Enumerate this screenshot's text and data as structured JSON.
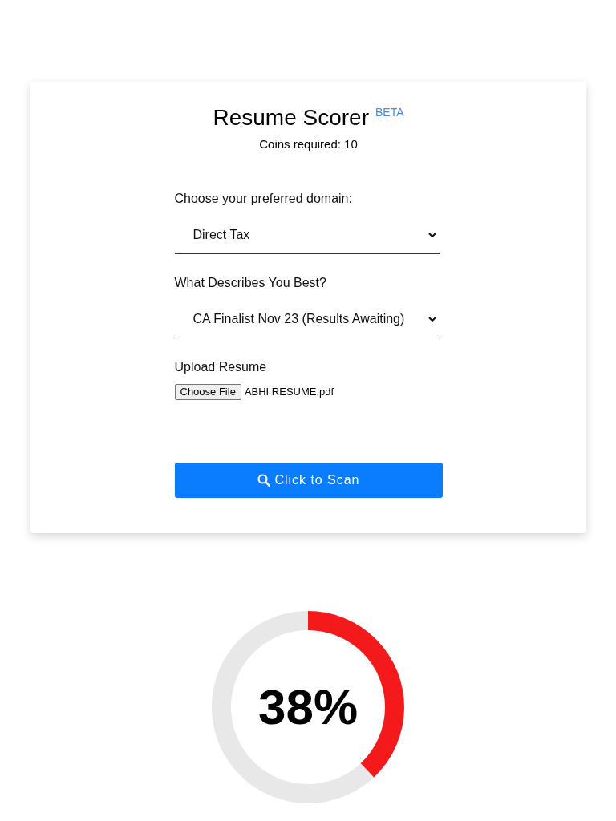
{
  "header": {
    "title": "Resume Scorer",
    "badge": "BETA",
    "coins": "Coins required: 10"
  },
  "fields": [
    {
      "kind": "select",
      "label": "Choose your preferred domain:",
      "value": "Direct Tax"
    },
    {
      "kind": "select",
      "label": "What Describes You Best?",
      "value": "CA Finalist Nov 23 (Results Awaiting)"
    },
    {
      "kind": "file",
      "label": "Upload Resume",
      "button": "Choose File",
      "value": "ABHI RESUME.pdf"
    }
  ],
  "scan_button": {
    "label": "Click to Scan"
  },
  "score": {
    "level": 0.38,
    "text": "38%"
  }
}
